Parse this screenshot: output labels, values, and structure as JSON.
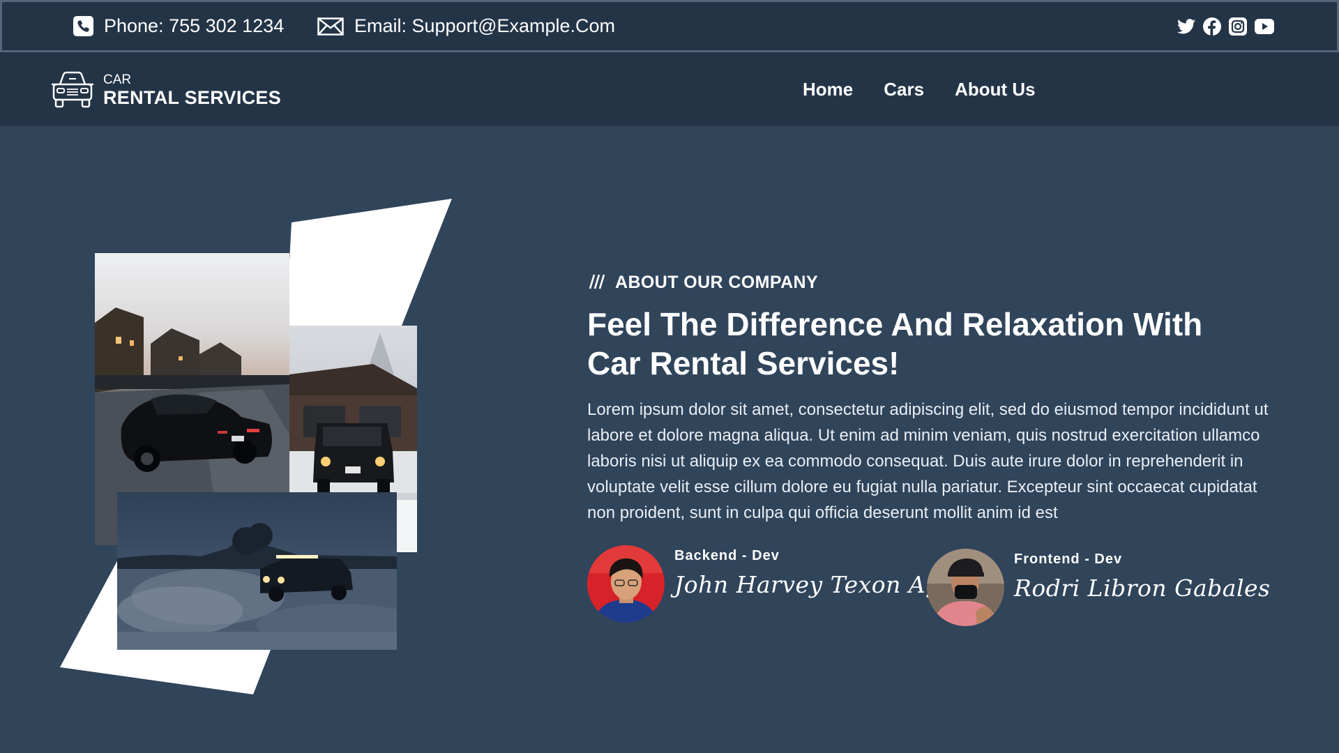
{
  "topbar": {
    "phone": "Phone: 755 302 1234",
    "email": "Email: Support@Example.Com",
    "socials": [
      "twitter-icon",
      "facebook-icon",
      "instagram-icon",
      "youtube-icon"
    ]
  },
  "logo": {
    "small": "CAR",
    "big": "RENTAL SERVICES",
    "icon": "car-icon"
  },
  "nav": {
    "items": [
      "Home",
      "Cars",
      "About Us"
    ]
  },
  "about": {
    "eyebrow": "ABOUT OUR COMPANY",
    "headline_line1": "Feel The Difference And Relaxation With",
    "headline_line2": "Car Rental Services!",
    "body": "Lorem ipsum dolor sit amet, consectetur adipiscing elit, sed do eiusmod tempor incididunt ut labore et dolore magna aliqua. Ut enim ad minim veniam, quis nostrud exercitation ullamco laboris nisi ut aliquip ex ea commodo consequat. Duis aute irure dolor in reprehenderit in voluptate velit esse cillum dolore eu fugiat nulla pariatur. Excepteur sint occaecat cupidatat non proident, sunt in culpa qui officia deserunt mollit anim id est"
  },
  "devs": [
    {
      "role": "Backend - Dev",
      "signature": "John Harvey Texon Agrabio"
    },
    {
      "role": "Frontend - Dev",
      "signature": "Rodri Libron Gabales"
    }
  ],
  "colors": {
    "page_bg": "#30445a",
    "bar_bg": "#243447",
    "text": "#ffffff"
  }
}
